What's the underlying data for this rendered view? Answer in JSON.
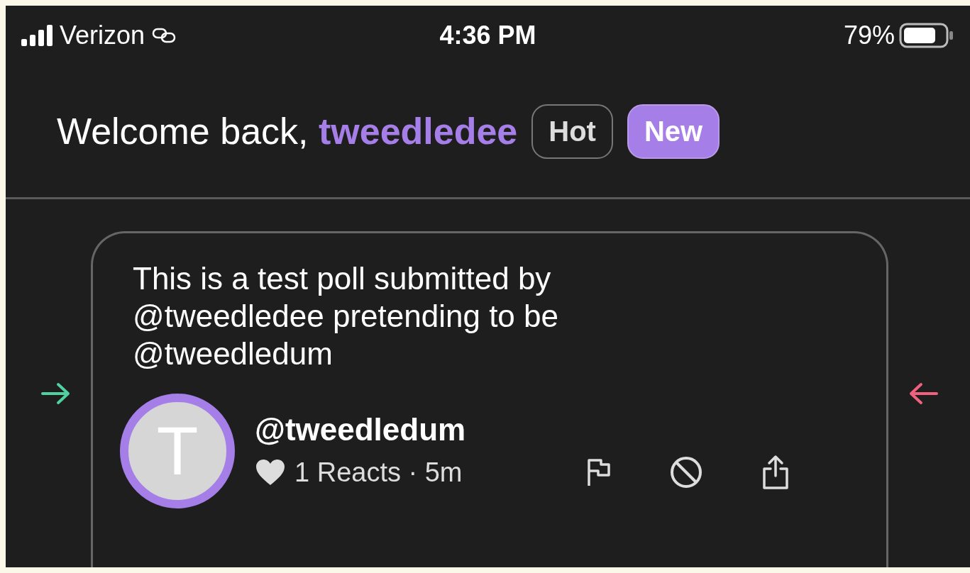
{
  "status_bar": {
    "carrier": "Verizon",
    "time": "4:36 PM",
    "battery_percent": "79%"
  },
  "header": {
    "greeting": "Welcome back, **tweedledee**",
    "tabs": [
      {
        "label": "Hot",
        "selected": false
      },
      {
        "label": "New",
        "selected": true
      }
    ]
  },
  "post": {
    "text": "This is a test poll submitted by @tweedledee pretending to be @tweedledum",
    "avatar_letter": "T",
    "author": "@tweedledum",
    "reacts": "1 Reacts · 5m"
  }
}
